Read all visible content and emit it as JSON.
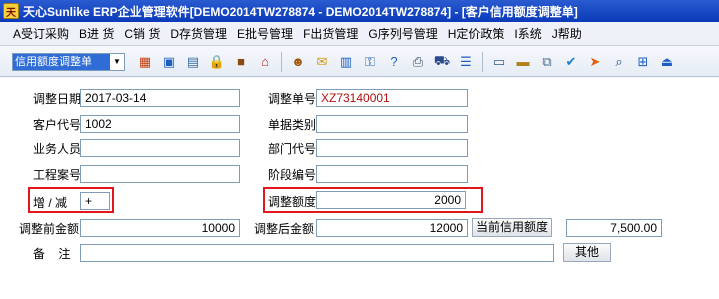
{
  "window": {
    "title": "天心Sunlike ERP企业管理软件[DEMO2014TW278874 - DEMO2014TW278874] - [客户信用额度调整单]"
  },
  "menu": {
    "items": [
      "A受订采购",
      "B进 货",
      "C销 货",
      "D存货管理",
      "E批号管理",
      "F出货管理",
      "G序列号管理",
      "H定价政策",
      "I系统",
      "J帮助"
    ]
  },
  "toolbar": {
    "combo_value": "信用额度调整单",
    "icons": [
      "table-icon",
      "monitor-icon",
      "computer-icon",
      "lock-icon",
      "briefcase-icon",
      "house-icon",
      "people-icon",
      "mail-icon",
      "book-icon",
      "key-icon",
      "help-icon",
      "print-icon",
      "cart-icon",
      "list-icon",
      "document-icon",
      "folder-icon",
      "copy-icon",
      "check-icon",
      "arrow-icon",
      "preview-icon",
      "network-icon",
      "exit-icon"
    ]
  },
  "form": {
    "date_label": "调整日期",
    "date_value": "2017-03-14",
    "doc_no_label": "调整单号",
    "doc_no_value": "XZ73140001",
    "customer_code_label": "客户代号",
    "customer_code_value": "1002",
    "doc_type_label": "单据类别",
    "doc_type_value": "",
    "salesperson_label": "业务人员",
    "salesperson_value": "",
    "dept_label": "部门代号",
    "dept_value": "",
    "project_label": "工程案号",
    "project_value": "",
    "stage_label": "阶段编号",
    "stage_value": "",
    "inc_dec_label": "增 / 减",
    "inc_dec_value": "+",
    "adjust_amount_label": "调整额度",
    "adjust_amount_value": "2000",
    "before_amount_label": "调整前金额",
    "before_amount_value": "10000",
    "after_amount_label": "调整后金额",
    "after_amount_value": "12000",
    "current_credit_button": "当前信用额度",
    "current_credit_value": "7,500.00",
    "remark_label": "备    注",
    "remark_value": "",
    "other_button": "其他"
  }
}
